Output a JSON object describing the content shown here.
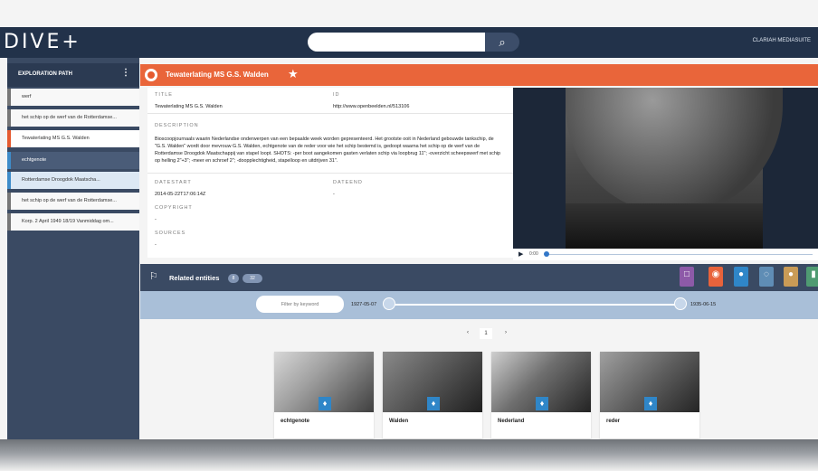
{
  "app": {
    "logo_text": "DIVE+",
    "search": {
      "placeholder": "",
      "button_icon": "search-icon"
    },
    "user_label": "CLARIAH MEDIASUITE"
  },
  "sidebar": {
    "title": "EXPLORATION PATH",
    "menu_icon": "more-vertical-icon",
    "items": [
      {
        "label": "werf"
      },
      {
        "label": "het schip op de werf van de Rotterdamse..."
      },
      {
        "label": "Tewaterlating MS G.S. Walden"
      },
      {
        "label": "echtgenote"
      },
      {
        "label": "Rotterdamse Droogdok Maatscha..."
      },
      {
        "label": "het schip op de werf van de Rotterdamse..."
      },
      {
        "label": "Korp. 2 April 1949 18/19 Vanmiddag om..."
      }
    ]
  },
  "record": {
    "title": "Tewaterlating MS G.S. Walden",
    "favorite_icon": "star-icon",
    "fields": {
      "title_label": "TITLE",
      "title_value": "Tewaterlating MS G.S. Walden",
      "id_label": "ID",
      "id_value": "http://www.openbeelden.nl/513106",
      "description_label": "DESCRIPTION",
      "description_value": "Bioscoopjournaals waarin Nederlandse onderwerpen van een bepaalde week worden gepresenteerd. Het grootste ooit in Nederland gebouwde tankschip, de \"G.S. Walden\" wordt door mevrouw G.S. Walden, echtgenote van de reder voor wie het schip bestemd is, gedoopt waarna het schip op de werf van de Rotterdamse Droogdok Maatschappij van stapel loopt. SHOTS: -per boot aangekomen gasten verlaten schip via loopbrug 11\"; -overzicht scheepswerf met schip op helling 2\"+3\"; -meer en schroef 2\"; -doopplechtigheid, stapelloop en uitdrijven 31\".",
      "datestart_label": "DATESTART",
      "datestart_value": "2014-05-22T17:06:14Z",
      "dateend_label": "DATEEND",
      "dateend_value": "-",
      "copyright_label": "COPYRIGHT",
      "copyright_value": "-",
      "sources_label": "SOURCES",
      "sources_value": "-"
    },
    "video": {
      "time": "0:00",
      "play_icon": "play-icon"
    }
  },
  "related": {
    "title": "Related entities",
    "count_a": "8",
    "count_b": "32",
    "icon": "network-icon",
    "filter_placeholder": "Filter by keyword",
    "date_start": "1927-05-07",
    "date_end": "1935-06-15",
    "pager": {
      "prev": "‹",
      "current": "1",
      "next": "›"
    },
    "type_filters": [
      {
        "name": "calendar-icon",
        "color": "#8d5aa8"
      },
      {
        "name": "media-icon",
        "color": "#e8633b"
      },
      {
        "name": "location-icon",
        "color": "#2f86c8"
      },
      {
        "name": "pin-icon",
        "color": "#5f8db5"
      },
      {
        "name": "person-icon",
        "color": "#c99b56"
      },
      {
        "name": "tag-icon",
        "color": "#4f9b72"
      }
    ],
    "cards": [
      {
        "title": "echtgenote",
        "icon": "location-icon"
      },
      {
        "title": "Walden",
        "icon": "location-icon"
      },
      {
        "title": "Nederland",
        "icon": "location-icon"
      },
      {
        "title": "reder",
        "icon": "location-icon"
      }
    ]
  }
}
